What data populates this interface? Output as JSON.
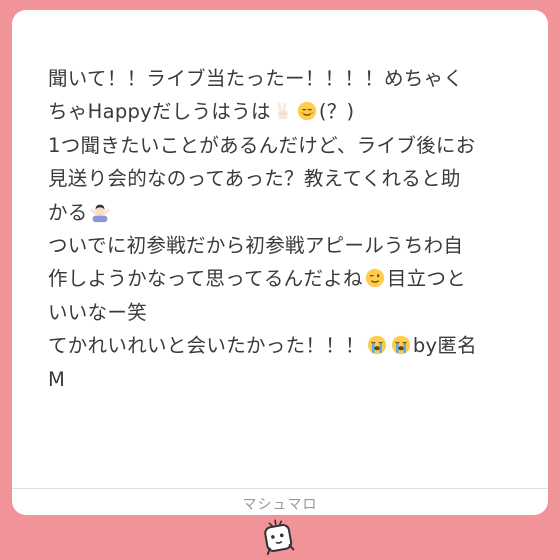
{
  "message": {
    "lines": [
      "聞いて！！ライブ当たったー！！！！めちゃく",
      "ちゃHappyだしうはうは",
      "(？)",
      "1つ聞きたいことがあるんだけど、ライブ後にお",
      "見送り会的なのってあった？教えてくれると助",
      "かる",
      "ついでに初参戦だから初参戦アピールうちわ自",
      "作しようかなって思ってるんだよね",
      "目立つと",
      "いいなー笑",
      "てかれいれいと会いたかった！！！",
      "by匿名",
      "M"
    ]
  },
  "footer": {
    "brand": "マシュマロ"
  },
  "icons": {
    "peace": "peace-hand-icon",
    "relieved": "relieved-face-icon",
    "ok_person": "person-gesturing-ok-icon",
    "wink": "winking-face-icon",
    "crying": "loudly-crying-face-icon",
    "mascot": "marshmallow-mascot-icon"
  },
  "colors": {
    "background": "#f0949a",
    "card": "#ffffff",
    "text": "#3a3a3a",
    "footer_text": "#9a9a9a"
  }
}
